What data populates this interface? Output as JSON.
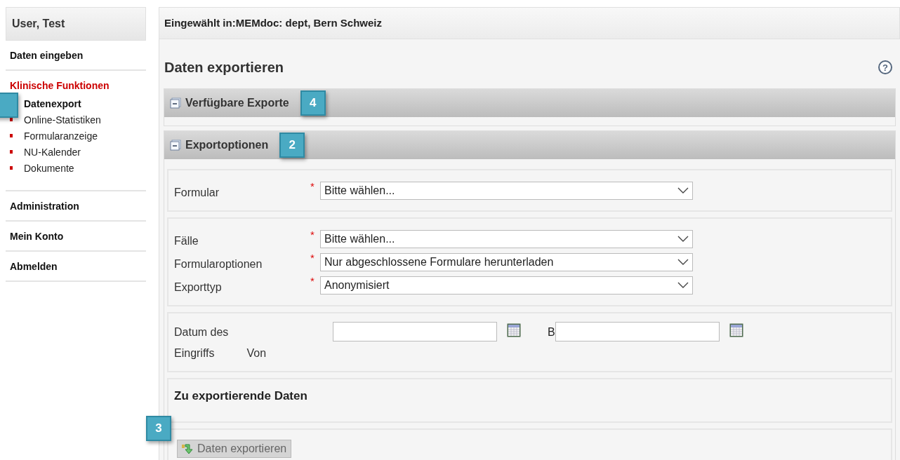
{
  "sidebar": {
    "user": "User, Test",
    "items": [
      {
        "label": "Daten eingeben",
        "active": false
      },
      {
        "label": "Klinische Funktionen",
        "active": true,
        "children": [
          {
            "label": "Datenexport",
            "selected": true
          },
          {
            "label": "Online-Statistiken",
            "selected": false
          },
          {
            "label": "Formularanzeige",
            "selected": false
          },
          {
            "label": "NU-Kalender",
            "selected": false
          },
          {
            "label": "Dokumente",
            "selected": false
          }
        ]
      },
      {
        "label": "Administration",
        "active": false
      },
      {
        "label": "Mein Konto",
        "active": false
      },
      {
        "label": "Abmelden",
        "active": false
      }
    ]
  },
  "help_icon": "?",
  "required_mark": "*",
  "header": "Eingewählt in:MEMdoc: dept, Bern Schweiz",
  "page_title": "Daten exportieren",
  "sections": [
    {
      "title": "Verfügbare Exporte",
      "expanded": true,
      "callout": "4"
    },
    {
      "title": "Exportoptionen",
      "expanded": true,
      "callout": "2"
    }
  ],
  "field_groups": [
    [
      {
        "label": "Formular",
        "required": true,
        "value": "Bitte wählen..."
      }
    ],
    [
      {
        "label": "Fälle",
        "required": true,
        "value": "Bitte wählen..."
      },
      {
        "label": "Formularoptionen",
        "required": true,
        "value": "Nur abgeschlossene Formulare herunterladen"
      },
      {
        "label": "Exporttyp",
        "required": true,
        "value": "Anonymisiert"
      }
    ]
  ],
  "date": {
    "label_1": "Datum des",
    "label_2": "Eingriffs",
    "from": "Von",
    "to": "B"
  },
  "data_heading": "Zu exportierende Daten",
  "export_button": {
    "label": "Daten exportieren",
    "callout": "3"
  }
}
